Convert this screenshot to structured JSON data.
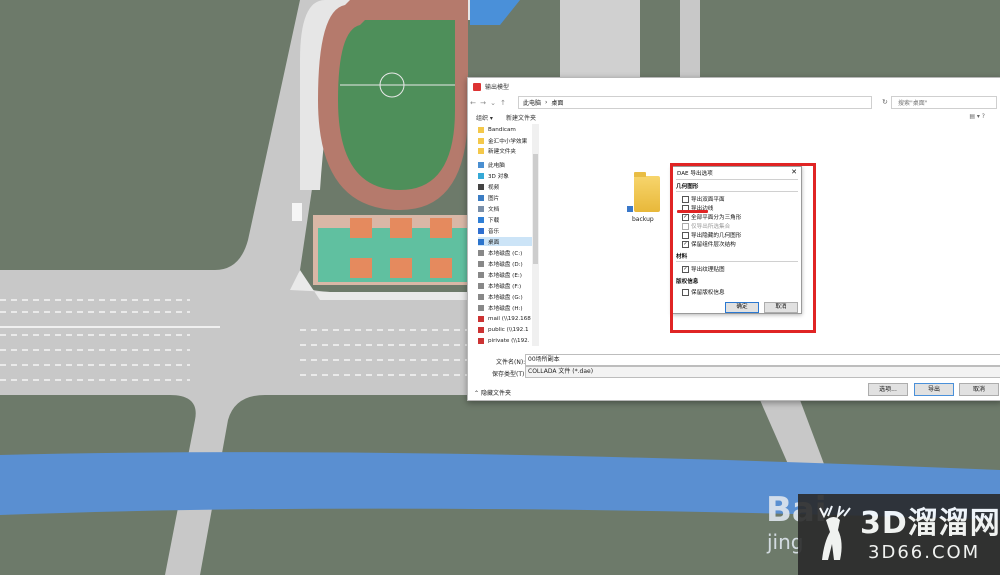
{
  "dialog": {
    "title": "输出模型",
    "breadcrumb": [
      "此电脑",
      "桌面"
    ],
    "search_placeholder": "搜索\"桌面\"",
    "organize": "组织 ▾",
    "new_folder": "新建文件夹",
    "nav_items": [
      {
        "label": "Bandicam",
        "icon": "folder-icon"
      },
      {
        "label": "金汇中小学效果",
        "icon": "folder-icon"
      },
      {
        "label": "新建文件夹",
        "icon": "folder-icon"
      },
      {
        "label": "此电脑",
        "icon": "computer-icon"
      },
      {
        "label": "3D 对象",
        "icon": "cube-icon"
      },
      {
        "label": "视频",
        "icon": "video-icon"
      },
      {
        "label": "图片",
        "icon": "picture-icon"
      },
      {
        "label": "文档",
        "icon": "document-icon"
      },
      {
        "label": "下载",
        "icon": "download-icon"
      },
      {
        "label": "音乐",
        "icon": "music-icon"
      },
      {
        "label": "桌面",
        "icon": "desktop-icon"
      },
      {
        "label": "本地磁盘 (C:)",
        "icon": "disk-icon"
      },
      {
        "label": "本地磁盘 (D:)",
        "icon": "disk-icon"
      },
      {
        "label": "本地磁盘 (E:)",
        "icon": "disk-icon"
      },
      {
        "label": "本地磁盘 (F:)",
        "icon": "disk-icon"
      },
      {
        "label": "本地磁盘 (G:)",
        "icon": "disk-icon"
      },
      {
        "label": "本地磁盘 (H:)",
        "icon": "disk-icon"
      },
      {
        "label": "mail (\\\\192.168",
        "icon": "network-drive-icon"
      },
      {
        "label": "public (\\\\192.1",
        "icon": "network-drive-icon"
      },
      {
        "label": "pirivate (\\\\192.",
        "icon": "network-drive-icon"
      }
    ],
    "files": [
      {
        "name": "backup",
        "icon": "folder-shortcut-icon"
      }
    ],
    "filename_label": "文件名(N):",
    "filename_value": "00场所副本",
    "filetype_label": "保存类型(T):",
    "filetype_value": "COLLADA 文件 (*.dae)",
    "hide_folders": "隐藏文件夹",
    "btn_options": "选项...",
    "btn_export": "导出",
    "btn_cancel": "取消"
  },
  "dae_options": {
    "title": "DAE 导出选项",
    "section_geometry": "几何图形",
    "geometry_items": [
      {
        "label": "导出双面平面",
        "checked": false,
        "disabled": false
      },
      {
        "label": "导出边线",
        "checked": false,
        "disabled": false
      },
      {
        "label": "全部平面分为三角形",
        "checked": true,
        "disabled": false
      },
      {
        "label": "仅导出所选集合",
        "checked": false,
        "disabled": true
      },
      {
        "label": "导出隐藏的几何图形",
        "checked": false,
        "disabled": false
      },
      {
        "label": "保留组件层次结构",
        "checked": true,
        "disabled": false
      }
    ],
    "section_material": "材料",
    "material_items": [
      {
        "label": "导出纹理贴图",
        "checked": true,
        "disabled": false
      }
    ],
    "section_credits": "版权信息",
    "credit_items": [
      {
        "label": "保留版权信息",
        "checked": false,
        "disabled": false
      }
    ],
    "ok": "确定",
    "cancel": "取消"
  },
  "watermark": {
    "line1": "3D溜溜网",
    "line2": "3D66.COM",
    "baidu1": "Bai",
    "baidu2": "jing"
  },
  "colors": {
    "highlight": "#e02424",
    "accent": "#2b78d0"
  }
}
